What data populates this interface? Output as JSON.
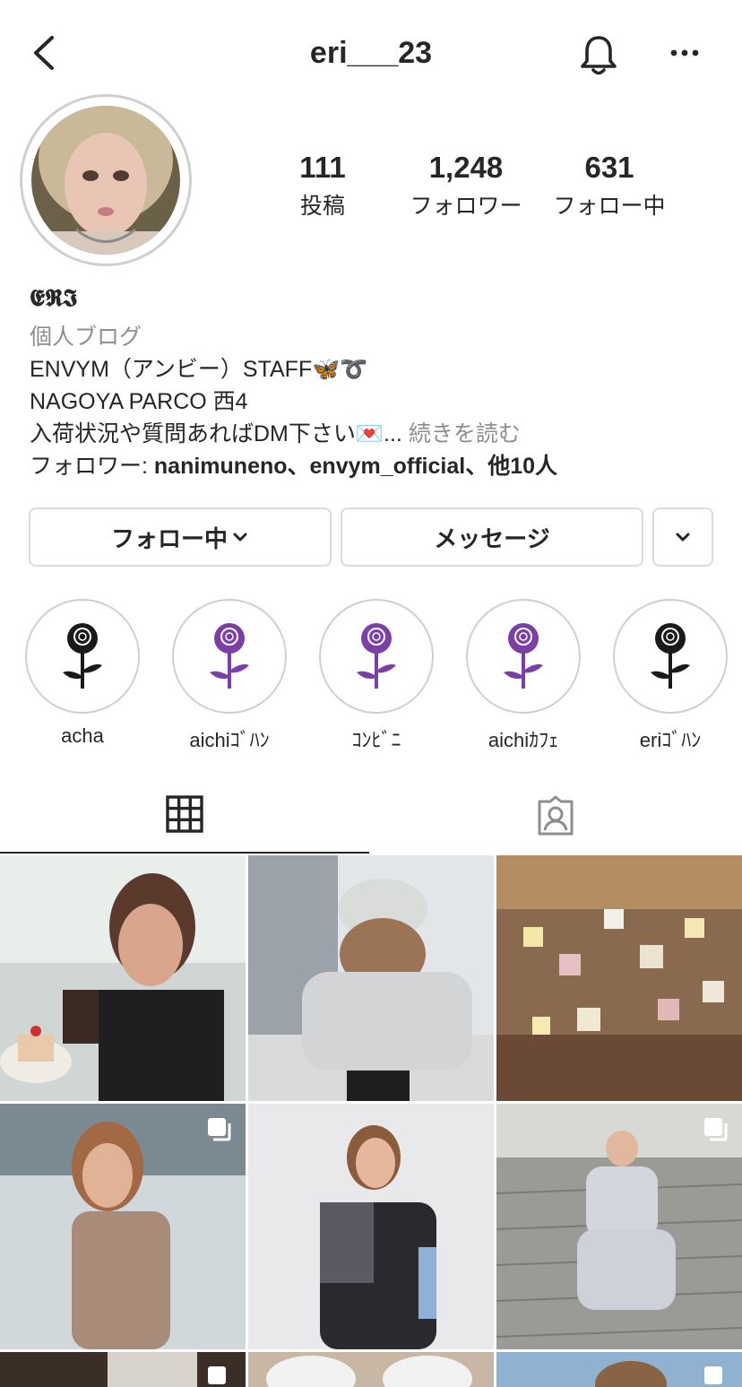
{
  "header": {
    "username": "eri___23"
  },
  "stats": [
    {
      "value": "111",
      "label": "投稿"
    },
    {
      "value": "1,248",
      "label": "フォロワー"
    },
    {
      "value": "631",
      "label": "フォロー中"
    }
  ],
  "bio": {
    "display_name": "𝕰𝕽𝕴",
    "category": "個人ブログ",
    "line1": "ENVYM（アンビー）STAFF🦋➰",
    "line2": "NAGOYA PARCO  西4",
    "line3": "入荷状況や質問あればDM下さい💌...",
    "more": "続きを読む",
    "followers_prefix": "フォロワー: ",
    "followers_names": "nanimuneno、envym_official、他10人"
  },
  "buttons": {
    "following": "フォロー中",
    "message": "メッセージ"
  },
  "highlights": [
    {
      "label": "acha",
      "color": "#1a1a1a"
    },
    {
      "label": "aichiｺﾞﾊﾝ",
      "color": "#7b3fa6"
    },
    {
      "label": "ｺﾝﾋﾞﾆ",
      "color": "#7b3fa6"
    },
    {
      "label": "aichiｶﾌｪ",
      "color": "#7b3fa6"
    },
    {
      "label": "eriｺﾞﾊﾝ",
      "color": "#1a1a1a"
    }
  ],
  "icons": [
    "back-arrow-icon",
    "bell-icon",
    "more-icon",
    "grid-icon",
    "tagged-icon",
    "multi-photo-icon",
    "chevron-down-icon"
  ]
}
